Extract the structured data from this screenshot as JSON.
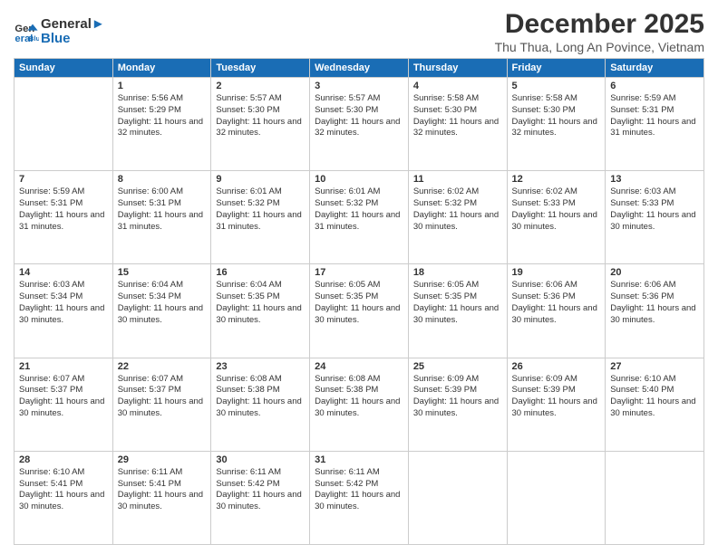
{
  "logo": {
    "line1": "General",
    "line2": "Blue"
  },
  "title": "December 2025",
  "subtitle": "Thu Thua, Long An Povince, Vietnam",
  "days_of_week": [
    "Sunday",
    "Monday",
    "Tuesday",
    "Wednesday",
    "Thursday",
    "Friday",
    "Saturday"
  ],
  "weeks": [
    [
      {
        "day": "",
        "sunrise": "",
        "sunset": "",
        "daylight": ""
      },
      {
        "day": "1",
        "sunrise": "5:56 AM",
        "sunset": "5:29 PM",
        "daylight": "11 hours and 32 minutes."
      },
      {
        "day": "2",
        "sunrise": "5:57 AM",
        "sunset": "5:30 PM",
        "daylight": "11 hours and 32 minutes."
      },
      {
        "day": "3",
        "sunrise": "5:57 AM",
        "sunset": "5:30 PM",
        "daylight": "11 hours and 32 minutes."
      },
      {
        "day": "4",
        "sunrise": "5:58 AM",
        "sunset": "5:30 PM",
        "daylight": "11 hours and 32 minutes."
      },
      {
        "day": "5",
        "sunrise": "5:58 AM",
        "sunset": "5:30 PM",
        "daylight": "11 hours and 32 minutes."
      },
      {
        "day": "6",
        "sunrise": "5:59 AM",
        "sunset": "5:31 PM",
        "daylight": "11 hours and 31 minutes."
      }
    ],
    [
      {
        "day": "7",
        "sunrise": "5:59 AM",
        "sunset": "5:31 PM",
        "daylight": "11 hours and 31 minutes."
      },
      {
        "day": "8",
        "sunrise": "6:00 AM",
        "sunset": "5:31 PM",
        "daylight": "11 hours and 31 minutes."
      },
      {
        "day": "9",
        "sunrise": "6:01 AM",
        "sunset": "5:32 PM",
        "daylight": "11 hours and 31 minutes."
      },
      {
        "day": "10",
        "sunrise": "6:01 AM",
        "sunset": "5:32 PM",
        "daylight": "11 hours and 31 minutes."
      },
      {
        "day": "11",
        "sunrise": "6:02 AM",
        "sunset": "5:32 PM",
        "daylight": "11 hours and 30 minutes."
      },
      {
        "day": "12",
        "sunrise": "6:02 AM",
        "sunset": "5:33 PM",
        "daylight": "11 hours and 30 minutes."
      },
      {
        "day": "13",
        "sunrise": "6:03 AM",
        "sunset": "5:33 PM",
        "daylight": "11 hours and 30 minutes."
      }
    ],
    [
      {
        "day": "14",
        "sunrise": "6:03 AM",
        "sunset": "5:34 PM",
        "daylight": "11 hours and 30 minutes."
      },
      {
        "day": "15",
        "sunrise": "6:04 AM",
        "sunset": "5:34 PM",
        "daylight": "11 hours and 30 minutes."
      },
      {
        "day": "16",
        "sunrise": "6:04 AM",
        "sunset": "5:35 PM",
        "daylight": "11 hours and 30 minutes."
      },
      {
        "day": "17",
        "sunrise": "6:05 AM",
        "sunset": "5:35 PM",
        "daylight": "11 hours and 30 minutes."
      },
      {
        "day": "18",
        "sunrise": "6:05 AM",
        "sunset": "5:35 PM",
        "daylight": "11 hours and 30 minutes."
      },
      {
        "day": "19",
        "sunrise": "6:06 AM",
        "sunset": "5:36 PM",
        "daylight": "11 hours and 30 minutes."
      },
      {
        "day": "20",
        "sunrise": "6:06 AM",
        "sunset": "5:36 PM",
        "daylight": "11 hours and 30 minutes."
      }
    ],
    [
      {
        "day": "21",
        "sunrise": "6:07 AM",
        "sunset": "5:37 PM",
        "daylight": "11 hours and 30 minutes."
      },
      {
        "day": "22",
        "sunrise": "6:07 AM",
        "sunset": "5:37 PM",
        "daylight": "11 hours and 30 minutes."
      },
      {
        "day": "23",
        "sunrise": "6:08 AM",
        "sunset": "5:38 PM",
        "daylight": "11 hours and 30 minutes."
      },
      {
        "day": "24",
        "sunrise": "6:08 AM",
        "sunset": "5:38 PM",
        "daylight": "11 hours and 30 minutes."
      },
      {
        "day": "25",
        "sunrise": "6:09 AM",
        "sunset": "5:39 PM",
        "daylight": "11 hours and 30 minutes."
      },
      {
        "day": "26",
        "sunrise": "6:09 AM",
        "sunset": "5:39 PM",
        "daylight": "11 hours and 30 minutes."
      },
      {
        "day": "27",
        "sunrise": "6:10 AM",
        "sunset": "5:40 PM",
        "daylight": "11 hours and 30 minutes."
      }
    ],
    [
      {
        "day": "28",
        "sunrise": "6:10 AM",
        "sunset": "5:41 PM",
        "daylight": "11 hours and 30 minutes."
      },
      {
        "day": "29",
        "sunrise": "6:11 AM",
        "sunset": "5:41 PM",
        "daylight": "11 hours and 30 minutes."
      },
      {
        "day": "30",
        "sunrise": "6:11 AM",
        "sunset": "5:42 PM",
        "daylight": "11 hours and 30 minutes."
      },
      {
        "day": "31",
        "sunrise": "6:11 AM",
        "sunset": "5:42 PM",
        "daylight": "11 hours and 30 minutes."
      },
      {
        "day": "",
        "sunrise": "",
        "sunset": "",
        "daylight": ""
      },
      {
        "day": "",
        "sunrise": "",
        "sunset": "",
        "daylight": ""
      },
      {
        "day": "",
        "sunrise": "",
        "sunset": "",
        "daylight": ""
      }
    ]
  ]
}
